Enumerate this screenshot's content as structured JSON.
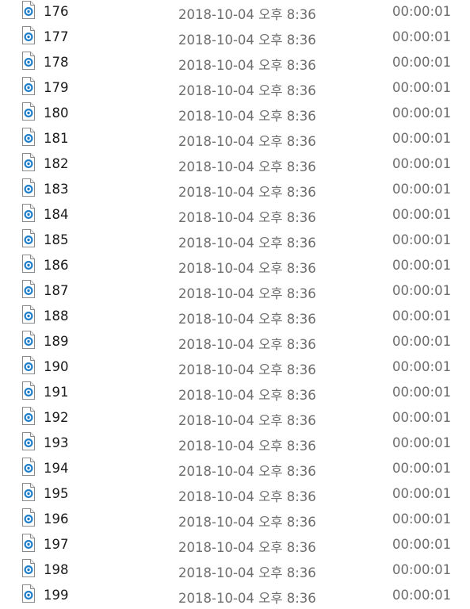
{
  "file_icon": "media-file-icon",
  "colors": {
    "icon_accent": "#1e7fc8",
    "name_text": "#1a1a1a",
    "detail_text": "#6d6d6d"
  },
  "files": [
    {
      "name": "176",
      "date": "2018-10-04 오후 8:36",
      "duration": "00:00:01"
    },
    {
      "name": "177",
      "date": "2018-10-04 오후 8:36",
      "duration": "00:00:01"
    },
    {
      "name": "178",
      "date": "2018-10-04 오후 8:36",
      "duration": "00:00:01"
    },
    {
      "name": "179",
      "date": "2018-10-04 오후 8:36",
      "duration": "00:00:01"
    },
    {
      "name": "180",
      "date": "2018-10-04 오후 8:36",
      "duration": "00:00:01"
    },
    {
      "name": "181",
      "date": "2018-10-04 오후 8:36",
      "duration": "00:00:01"
    },
    {
      "name": "182",
      "date": "2018-10-04 오후 8:36",
      "duration": "00:00:01"
    },
    {
      "name": "183",
      "date": "2018-10-04 오후 8:36",
      "duration": "00:00:01"
    },
    {
      "name": "184",
      "date": "2018-10-04 오후 8:36",
      "duration": "00:00:01"
    },
    {
      "name": "185",
      "date": "2018-10-04 오후 8:36",
      "duration": "00:00:01"
    },
    {
      "name": "186",
      "date": "2018-10-04 오후 8:36",
      "duration": "00:00:01"
    },
    {
      "name": "187",
      "date": "2018-10-04 오후 8:36",
      "duration": "00:00:01"
    },
    {
      "name": "188",
      "date": "2018-10-04 오후 8:36",
      "duration": "00:00:01"
    },
    {
      "name": "189",
      "date": "2018-10-04 오후 8:36",
      "duration": "00:00:01"
    },
    {
      "name": "190",
      "date": "2018-10-04 오후 8:36",
      "duration": "00:00:01"
    },
    {
      "name": "191",
      "date": "2018-10-04 오후 8:36",
      "duration": "00:00:01"
    },
    {
      "name": "192",
      "date": "2018-10-04 오후 8:36",
      "duration": "00:00:01"
    },
    {
      "name": "193",
      "date": "2018-10-04 오후 8:36",
      "duration": "00:00:01"
    },
    {
      "name": "194",
      "date": "2018-10-04 오후 8:36",
      "duration": "00:00:01"
    },
    {
      "name": "195",
      "date": "2018-10-04 오후 8:36",
      "duration": "00:00:01"
    },
    {
      "name": "196",
      "date": "2018-10-04 오후 8:36",
      "duration": "00:00:01"
    },
    {
      "name": "197",
      "date": "2018-10-04 오후 8:36",
      "duration": "00:00:01"
    },
    {
      "name": "198",
      "date": "2018-10-04 오후 8:36",
      "duration": "00:00:01"
    },
    {
      "name": "199",
      "date": "2018-10-04 오후 8:36",
      "duration": "00:00:01"
    }
  ]
}
